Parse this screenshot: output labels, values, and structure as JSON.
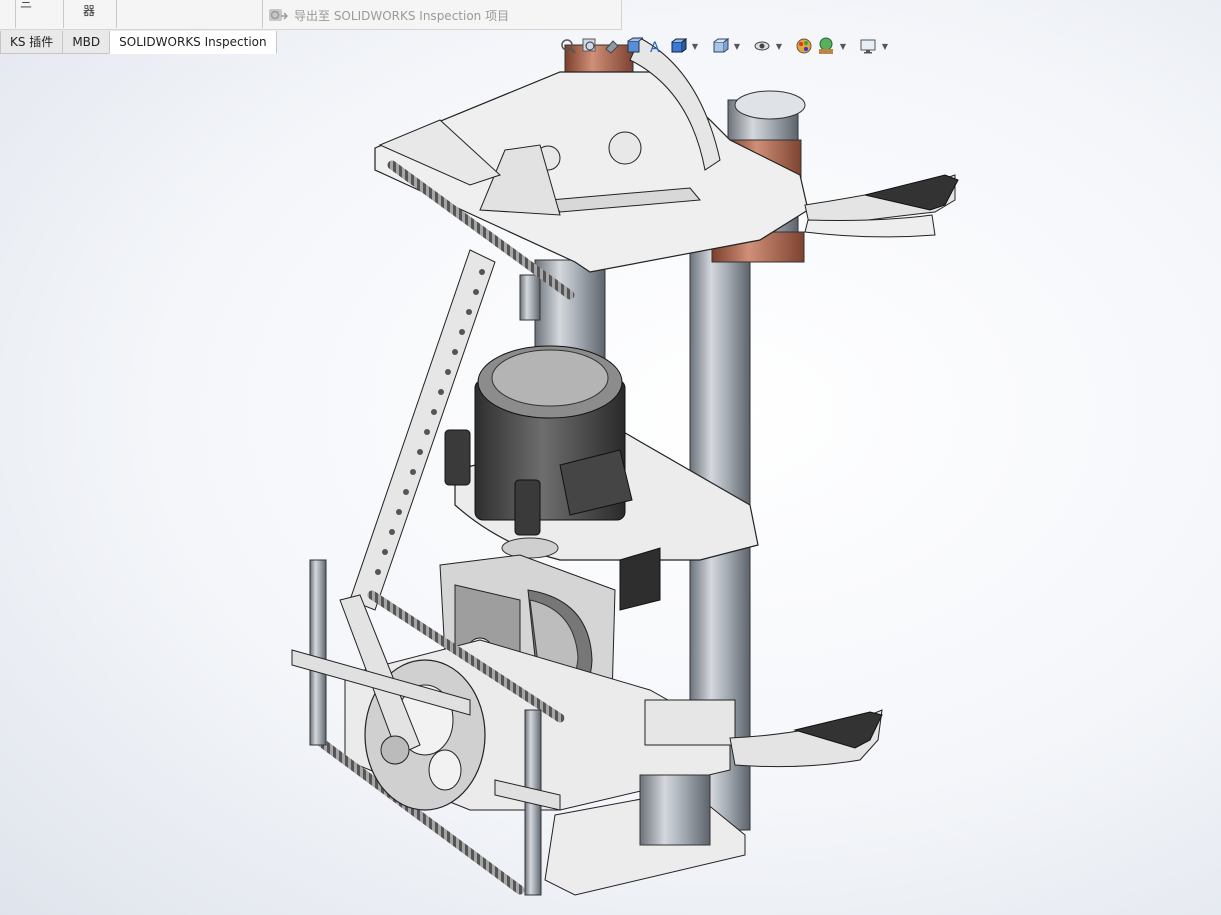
{
  "ribbon": {
    "fragment_left": "三",
    "fragment_mid": "器",
    "export_command": "导出至 SOLIDWORKS Inspection 项目"
  },
  "tabs": [
    {
      "label": "KS 插件",
      "active": false
    },
    {
      "label": "MBD",
      "active": false
    },
    {
      "label": "SOLIDWORKS Inspection",
      "active": true
    }
  ],
  "heads_up_toolbar": {
    "icons": [
      "zoom-to-fit-icon",
      "zoom-area-icon",
      "previous-view-icon",
      "section-view-icon",
      "dynamic-annotation-icon",
      "view-orientation-icon",
      "display-style-icon",
      "hide-show-icon",
      "edit-appearance-icon",
      "apply-scene-icon",
      "view-settings-icon"
    ]
  },
  "colors": {
    "viewport_center": "#ffffff",
    "viewport_edge": "#dfe4ec",
    "ribbon_bg": "#f5f5f5",
    "copper": "#b86a52",
    "steel": "#9aa0a8",
    "plate": "#ededed",
    "dark_part": "#3c3c3c"
  },
  "model": {
    "description_icon": "cad-assembly-icon"
  }
}
